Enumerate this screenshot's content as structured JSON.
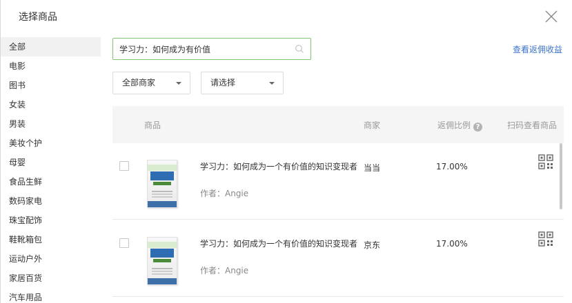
{
  "modal": {
    "title": "选择商品"
  },
  "sidebar": {
    "items": [
      {
        "label": "全部",
        "active": true
      },
      {
        "label": "电影"
      },
      {
        "label": "图书"
      },
      {
        "label": "女装"
      },
      {
        "label": "男装"
      },
      {
        "label": "美妆个护"
      },
      {
        "label": "母婴"
      },
      {
        "label": "食品生鲜"
      },
      {
        "label": "数码家电"
      },
      {
        "label": "珠宝配饰"
      },
      {
        "label": "鞋靴箱包"
      },
      {
        "label": "运动户外"
      },
      {
        "label": "家居百货"
      },
      {
        "label": "汽车用品"
      }
    ]
  },
  "search": {
    "value": "学习力：如何成为有价值",
    "icon": "search-icon"
  },
  "rebate_link": "查看返佣收益",
  "filters": {
    "merchant": "全部商家",
    "choose": "请选择"
  },
  "table": {
    "headers": {
      "product": "商品",
      "merchant": "商家",
      "ratio": "返佣比例",
      "qr": "扫码查看商品"
    },
    "rows": [
      {
        "name": "学习力：如何成为一个有价值的知识变现者",
        "author": "作者：Angie",
        "merchant": "当当",
        "ratio": "17.00%"
      },
      {
        "name": "学习力：如何成为一个有价值的知识变现者",
        "author": "作者：Angie",
        "merchant": "京东",
        "ratio": "17.00%"
      }
    ]
  },
  "colors": {
    "search_border": "#7fc66e",
    "link": "#3b73c8",
    "header_bg": "#f5f5f5"
  }
}
